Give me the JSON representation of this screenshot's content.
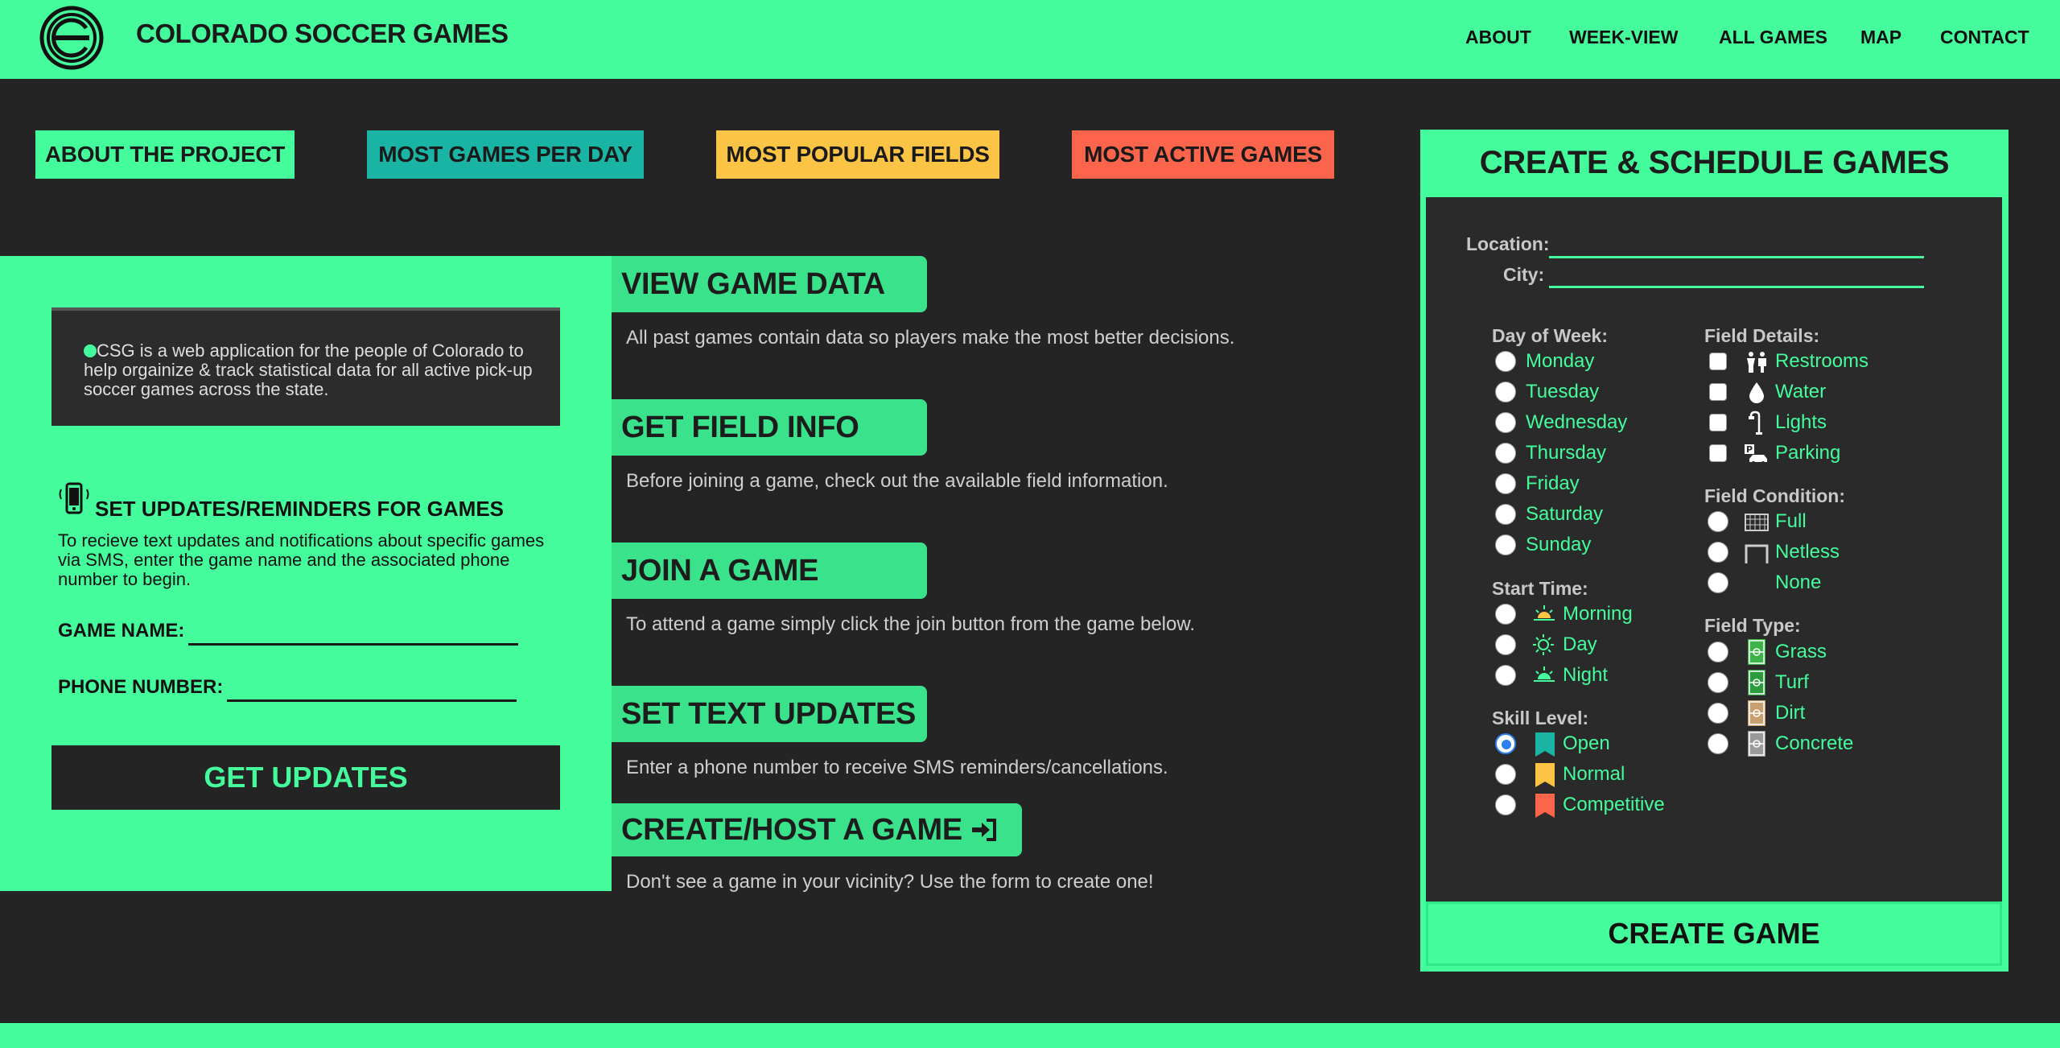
{
  "header": {
    "brand": "COLORADO SOCCER GAMES",
    "nav": [
      "ABOUT",
      "WEEK-VIEW",
      "ALL GAMES",
      "MAP",
      "CONTACT"
    ]
  },
  "stat_buttons": [
    {
      "label": "ABOUT THE PROJECT",
      "color": "#44fc9c"
    },
    {
      "label": "MOST GAMES PER DAY",
      "color": "#1ab4a4"
    },
    {
      "label": "MOST POPULAR FIELDS",
      "color": "#fcc444"
    },
    {
      "label": "MOST ACTIVE GAMES",
      "color": "#fc644c"
    }
  ],
  "about": {
    "text": "CSG is a web application for the people of Colorado to help orgainize & track statistical data for all active pick-up soccer games across the state."
  },
  "sms": {
    "title": "SET UPDATES/REMINDERS FOR GAMES",
    "description": "To recieve text updates and notifications about specific games via SMS, enter the game name and the associated phone number to begin.",
    "game_name_label": "GAME NAME:",
    "phone_label": "PHONE NUMBER:",
    "button": "GET UPDATES"
  },
  "sections": [
    {
      "title": "VIEW GAME DATA",
      "desc": "All past games contain data so players make the most better decisions."
    },
    {
      "title": "GET FIELD INFO",
      "desc": "Before joining a game, check out the available field information."
    },
    {
      "title": "JOIN A GAME",
      "desc": "To attend a game simply click the join button from the game below."
    },
    {
      "title": "SET TEXT UPDATES",
      "desc": "Enter a phone number to receive SMS reminders/cancellations."
    },
    {
      "title": "CREATE/HOST A GAME",
      "desc": "Don't see a game in your vicinity? Use the form to create one!"
    }
  ],
  "form": {
    "title": "CREATE & SCHEDULE GAMES",
    "location_label": "Location:",
    "city_label": "City:",
    "day_label": "Day of Week:",
    "days": [
      "Monday",
      "Tuesday",
      "Wednesday",
      "Thursday",
      "Friday",
      "Saturday",
      "Sunday"
    ],
    "start_label": "Start Time:",
    "start_times": [
      "Morning",
      "Day",
      "Night"
    ],
    "skill_label": "Skill Level:",
    "skills": [
      "Open",
      "Normal",
      "Competitive"
    ],
    "skill_selected": "Open",
    "details_label": "Field Details:",
    "details": [
      "Restrooms",
      "Water",
      "Lights",
      "Parking"
    ],
    "condition_label": "Field Condition:",
    "conditions": [
      "Full",
      "Netless",
      "None"
    ],
    "type_label": "Field Type:",
    "types": [
      "Grass",
      "Turf",
      "Dirt",
      "Concrete"
    ],
    "submit": "CREATE GAME"
  },
  "colors": {
    "accent": "#44fc9c",
    "background": "#242424",
    "skill_open": "#1ab4a4",
    "skill_normal": "#fcc444",
    "skill_competitive": "#fc644c"
  }
}
